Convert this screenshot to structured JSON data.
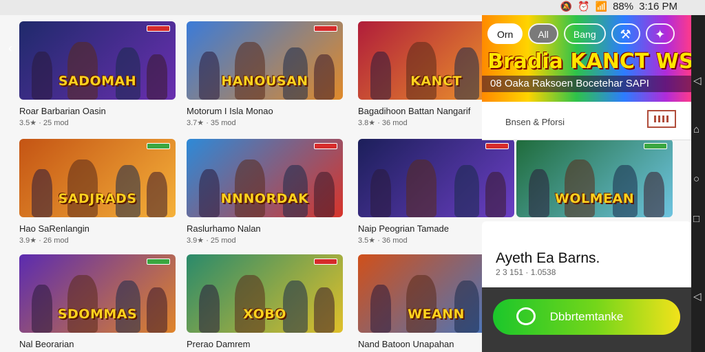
{
  "status_bar": {
    "icons": [
      "mute-icon",
      "alarm-icon",
      "wifi-icon",
      "signal-icon"
    ],
    "battery": "88%",
    "time": "3:16 PM"
  },
  "back_icon": "chevron-left-icon",
  "games": [
    {
      "name": "Roar Barbarian Oasin",
      "meta": "3.5★ · 25 mod",
      "art_title": "SADOMAH",
      "theme": [
        "#1f2a6b",
        "#6a2fb0"
      ],
      "badge": "red"
    },
    {
      "name": "Motorum I Isla Monao",
      "meta": "3.7★ · 35 mod",
      "art_title": "HANOUSAN",
      "theme": [
        "#3b7bd8",
        "#e08a2a"
      ],
      "badge": "red"
    },
    {
      "name": "Bagadihoon Battan Nangarif",
      "meta": "3.8★ · 36 mod",
      "art_title": "KANCT",
      "theme": [
        "#b01d3a",
        "#f2a02a"
      ],
      "badge": "red"
    },
    {
      "name": "Hao SaRenlangin",
      "meta": "3.9★ · 26 mod",
      "art_title": "SADJRADS",
      "theme": [
        "#c45414",
        "#f5b13a"
      ],
      "badge": "green"
    },
    {
      "name": "Raslurhamo Nalan",
      "meta": "3.9★ · 25 mod",
      "art_title": "NNNORDAK",
      "theme": [
        "#2d8ad8",
        "#d8342a"
      ],
      "badge": "red"
    },
    {
      "name": "Naip Peogrian Tamade",
      "meta": "3.5★ · 36 mod",
      "art_title": "",
      "theme": [
        "#1c1f5a",
        "#6b3fc4"
      ],
      "badge": "red"
    },
    {
      "name": "",
      "meta": "",
      "art_title": "WOLMEAN",
      "theme": [
        "#1f6b3a",
        "#6ec4e0"
      ],
      "badge": "green"
    },
    {
      "name": "Nal Beorarian",
      "meta": "",
      "art_title": "SDOMMAS",
      "theme": [
        "#5b2bb0",
        "#e0852a"
      ],
      "badge": "green"
    },
    {
      "name": "Prerao Damrem",
      "meta": "",
      "art_title": "XOBO",
      "theme": [
        "#2a8a6b",
        "#e0c02a"
      ],
      "badge": "red"
    },
    {
      "name": "Nand Batoon Unapahan",
      "meta": "",
      "art_title": "WEANN",
      "theme": [
        "#d0501a",
        "#3a7bd0"
      ],
      "badge": "red"
    }
  ],
  "panel": {
    "chips": [
      {
        "label": "Orn",
        "state": "default"
      },
      {
        "label": "All",
        "state": "selected"
      },
      {
        "label": "Bang",
        "state": "ghost"
      },
      {
        "label": "",
        "icon": "tools-icon"
      },
      {
        "label": "",
        "icon": "gamepad-icon"
      }
    ],
    "banner_title": "Bradia KANCT WSN CRAMY!",
    "banner_sub": "08 Oaka Raksoen Bocetehar SAPI",
    "section_label": "Bnsen & Pforsi",
    "info_title": "Ayeth Ea Barns.",
    "info_meta": "2 3 151 · 1.0538",
    "install_label": "Dbbrtemtanke",
    "install_icon": "chat-bubble-icon"
  },
  "nav": [
    "back-icon",
    "home-icon",
    "home-circle-icon",
    "recents-icon",
    "back-small-icon"
  ]
}
